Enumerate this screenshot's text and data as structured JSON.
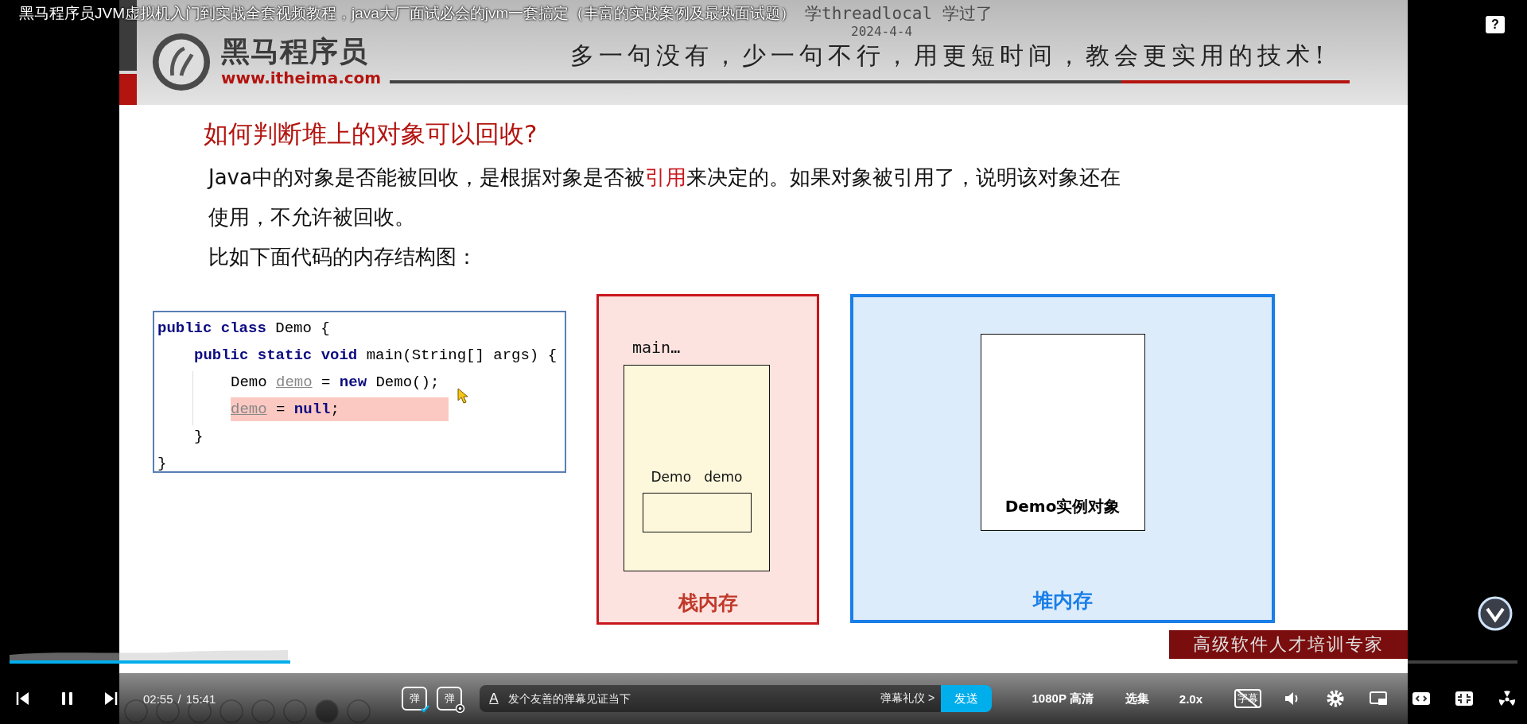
{
  "video_title": "黑马程序员JVM虚拟机入门到实战全套视频教程，java大厂面试必会的jvm一套搞定（丰富的实战案例及最热面试题）",
  "danmaku": [
    {
      "text": "学threadlocal 学过了"
    },
    {
      "text": "2024-4-4"
    }
  ],
  "help": {
    "glyph": "?"
  },
  "slide": {
    "logo_name": "黑马程序员",
    "logo_url": "www.itheima.com",
    "slogan": "多一句没有，少一句不行，用更短时间，教会更实用的技术!",
    "heading": "如何判断堆上的对象可以回收?",
    "paragraphs": [
      "Java中的对象是否能被回收，是根据对象是否被**引用**来决定的。如果对象被引用了，说明该对象还在使用，不允许被回收。",
      "比如下面代码的内存结构图："
    ],
    "code": [
      {
        "text": "**public class** Demo {",
        "highlighted": false,
        "children": [
          {
            "text": "**public static void** main(String[] args) {",
            "highlighted": false,
            "children": [
              {
                "text": "Demo *demo* = **new** Demo();",
                "highlighted": false
              },
              {
                "text": "*demo* = **null**;",
                "highlighted": true
              }
            ]
          },
          {
            "text": "}",
            "highlighted": false
          }
        ]
      },
      {
        "text": "}",
        "highlighted": false
      }
    ],
    "stack": {
      "frame_label": "main…",
      "variable_label": "Demo   demo",
      "caption": "栈内存"
    },
    "heap": {
      "object_label": "Demo实例对象",
      "caption": "堆内存"
    },
    "tagline": "高级软件人才培训专家"
  },
  "progress": {
    "level": 0.186
  },
  "controls": {
    "playing": true,
    "current_time": "02:55",
    "separator": "/",
    "duration": "15:41",
    "danmaku_toggle": {
      "glyph": "弹",
      "on": true
    },
    "danmaku_settings": {
      "glyph": "弹"
    },
    "input": {
      "glyph": "A",
      "placeholder": "发个友善的弹幕见证当下"
    },
    "etiquette": "弹幕礼仪 >",
    "send": "发送",
    "quality": "1080P 高清",
    "episodes": "选集",
    "speed": "2.0x",
    "subtitles": {
      "glyph": "字幕",
      "on": false
    }
  }
}
